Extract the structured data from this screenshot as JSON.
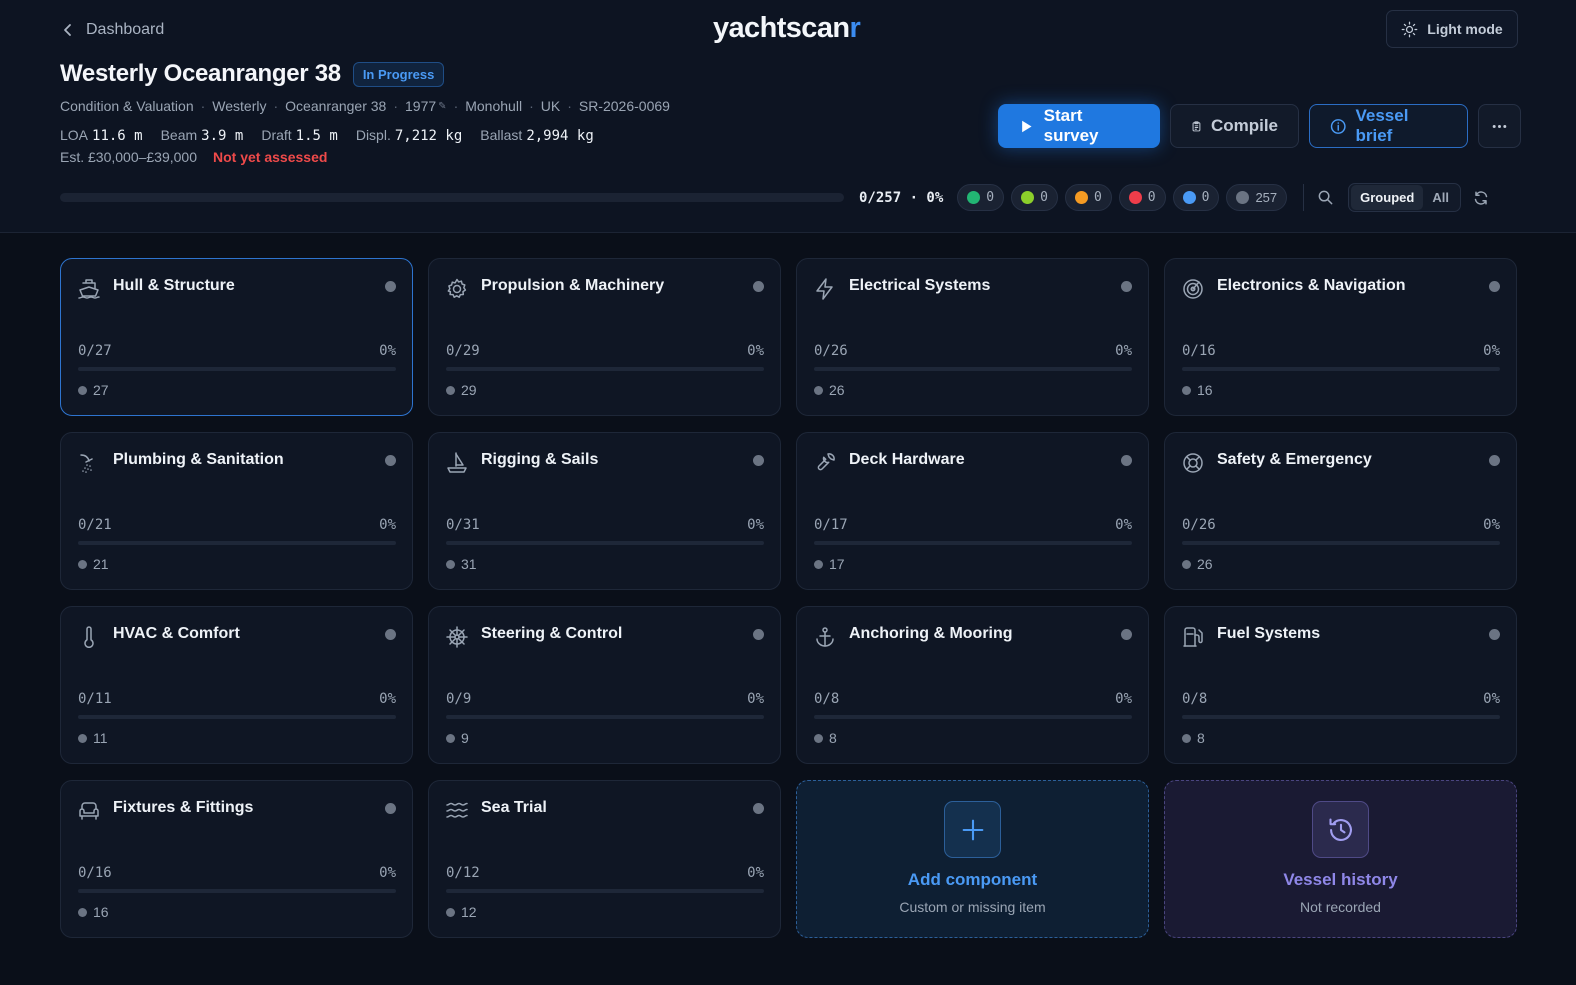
{
  "header": {
    "back_label": "Dashboard",
    "logo_main": "yachtscan",
    "logo_accent": "r",
    "light_mode_label": "Light mode"
  },
  "vessel": {
    "title": "Westerly Oceanranger 38",
    "status": "In Progress",
    "meta": [
      "Condition & Valuation",
      "Westerly",
      "Oceanranger 38",
      "1977",
      "Monohull",
      "UK",
      "SR-2026-0069"
    ],
    "specs": [
      {
        "label": "LOA",
        "value": "11.6 m"
      },
      {
        "label": "Beam",
        "value": "3.9 m"
      },
      {
        "label": "Draft",
        "value": "1.5 m"
      },
      {
        "label": "Displ.",
        "value": "7,212 kg"
      },
      {
        "label": "Ballast",
        "value": "2,994 kg"
      }
    ],
    "estimate": "Est. £30,000–£39,000",
    "assessment": "Not yet assessed"
  },
  "actions": {
    "start_survey": "Start survey",
    "compile": "Compile",
    "vessel_brief": "Vessel brief"
  },
  "progress": {
    "label": "0/257 · 0%",
    "fraction": 0,
    "chips": [
      {
        "color": "#22b573",
        "count": "0"
      },
      {
        "color": "#8ccf2b",
        "count": "0"
      },
      {
        "color": "#f59b23",
        "count": "0"
      },
      {
        "color": "#ef3d4a",
        "count": "0"
      },
      {
        "color": "#4a9af5",
        "count": "0"
      },
      {
        "color": "#6b7483",
        "count": "257"
      }
    ],
    "view_options": [
      "Grouped",
      "All"
    ]
  },
  "components": [
    {
      "name": "Hull & Structure",
      "icon": "ship-icon",
      "count": "0/27",
      "pct": "0%",
      "pending": "27"
    },
    {
      "name": "Propulsion & Machinery",
      "icon": "cog-icon",
      "count": "0/29",
      "pct": "0%",
      "pending": "29"
    },
    {
      "name": "Electrical Systems",
      "icon": "bolt-icon",
      "count": "0/26",
      "pct": "0%",
      "pending": "26"
    },
    {
      "name": "Electronics & Navigation",
      "icon": "radar-icon",
      "count": "0/16",
      "pct": "0%",
      "pending": "16"
    },
    {
      "name": "Plumbing & Sanitation",
      "icon": "shower-icon",
      "count": "0/21",
      "pct": "0%",
      "pending": "21"
    },
    {
      "name": "Rigging & Sails",
      "icon": "sailboat-icon",
      "count": "0/31",
      "pct": "0%",
      "pending": "31"
    },
    {
      "name": "Deck Hardware",
      "icon": "wrench-icon",
      "count": "0/17",
      "pct": "0%",
      "pending": "17"
    },
    {
      "name": "Safety & Emergency",
      "icon": "lifebuoy-icon",
      "count": "0/26",
      "pct": "0%",
      "pending": "26"
    },
    {
      "name": "HVAC & Comfort",
      "icon": "thermometer-icon",
      "count": "0/11",
      "pct": "0%",
      "pending": "11"
    },
    {
      "name": "Steering & Control",
      "icon": "helm-wheel-icon",
      "count": "0/9",
      "pct": "0%",
      "pending": "9"
    },
    {
      "name": "Anchoring & Mooring",
      "icon": "anchor-icon",
      "count": "0/8",
      "pct": "0%",
      "pending": "8"
    },
    {
      "name": "Fuel Systems",
      "icon": "fuel-pump-icon",
      "count": "0/8",
      "pct": "0%",
      "pending": "8"
    },
    {
      "name": "Fixtures & Fittings",
      "icon": "sofa-icon",
      "count": "0/16",
      "pct": "0%",
      "pending": "16"
    },
    {
      "name": "Sea Trial",
      "icon": "waves-icon",
      "count": "0/12",
      "pct": "0%",
      "pending": "12"
    }
  ],
  "add_component": {
    "title": "Add component",
    "subtitle": "Custom or missing item"
  },
  "vessel_history": {
    "title": "Vessel history",
    "subtitle": "Not recorded"
  }
}
